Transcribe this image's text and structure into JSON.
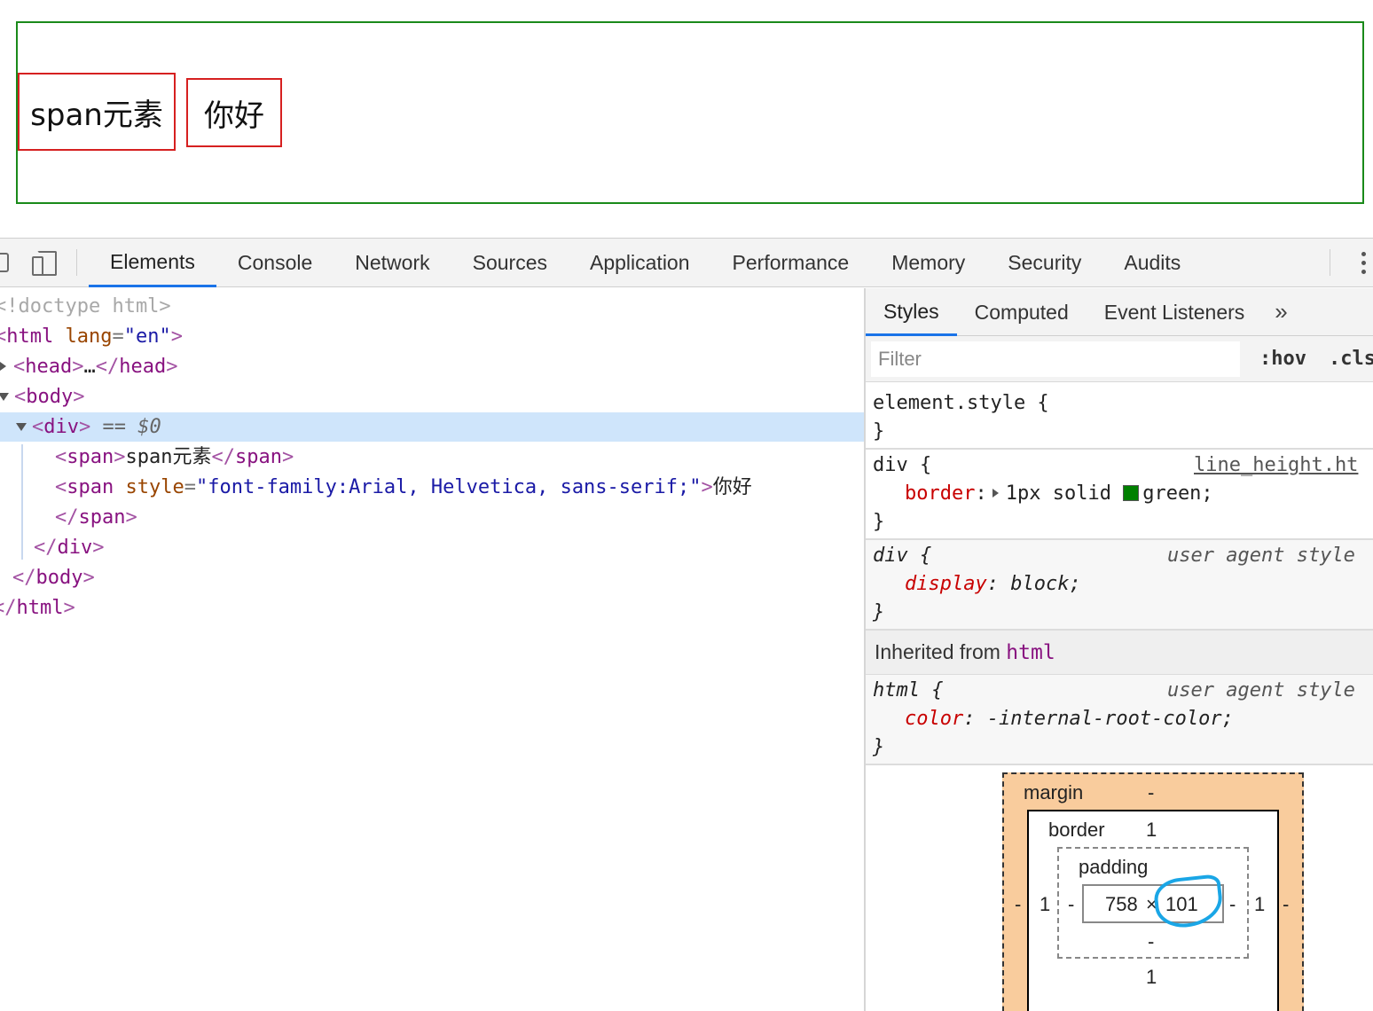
{
  "preview": {
    "span1_text": "span元素",
    "span2_text": "你好"
  },
  "toolbar": {
    "tabs": [
      "Elements",
      "Console",
      "Network",
      "Sources",
      "Application",
      "Performance",
      "Memory",
      "Security",
      "Audits"
    ],
    "active_tab": "Elements"
  },
  "dom": {
    "doctype": "<!doctype html>",
    "html_open_tag": "html",
    "html_attr_name": "lang",
    "html_attr_value": "\"en\"",
    "head_collapsed": "…",
    "body_tag": "body",
    "div_tag": "div",
    "selected_marker": "== $0",
    "span1_text": "span元素",
    "span2_attr_name": "style",
    "span2_attr_value": "\"font-family:Arial, Helvetica, sans-serif;\"",
    "span2_text": "你好",
    "span_tag": "span",
    "head_tag": "head"
  },
  "styles_pane": {
    "tabs": [
      "Styles",
      "Computed",
      "Event Listeners"
    ],
    "more_tabs": "»",
    "filter_placeholder": "Filter",
    "hov": ":hov",
    "cls": ".cls",
    "element_style": "element.style {",
    "close_brace": "}",
    "rule1": {
      "selector": "div {",
      "source": "line_height.ht",
      "property": "border",
      "value_prefix": "1px solid",
      "value_color": "green;",
      "swatch_color": "#008000"
    },
    "rule2": {
      "selector": "div {",
      "source": "user agent style",
      "property": "display",
      "value": "block;"
    },
    "inherited_label": "Inherited from",
    "inherited_tag": "html",
    "rule3": {
      "selector": "html {",
      "source": "user agent style",
      "property": "color",
      "value": "-internal-root-color;"
    }
  },
  "box_model": {
    "margin_label": "margin",
    "margin_top": "-",
    "margin_left": "-",
    "margin_right": "-",
    "border_label": "border",
    "border_top": "1",
    "border_left": "1",
    "border_right": "1",
    "border_bottom": "1",
    "padding_label": "padding",
    "padding_left": "-",
    "padding_right": "-",
    "padding_bottom": "-",
    "content_width": "758",
    "content_times": "×",
    "content_height": "101"
  }
}
